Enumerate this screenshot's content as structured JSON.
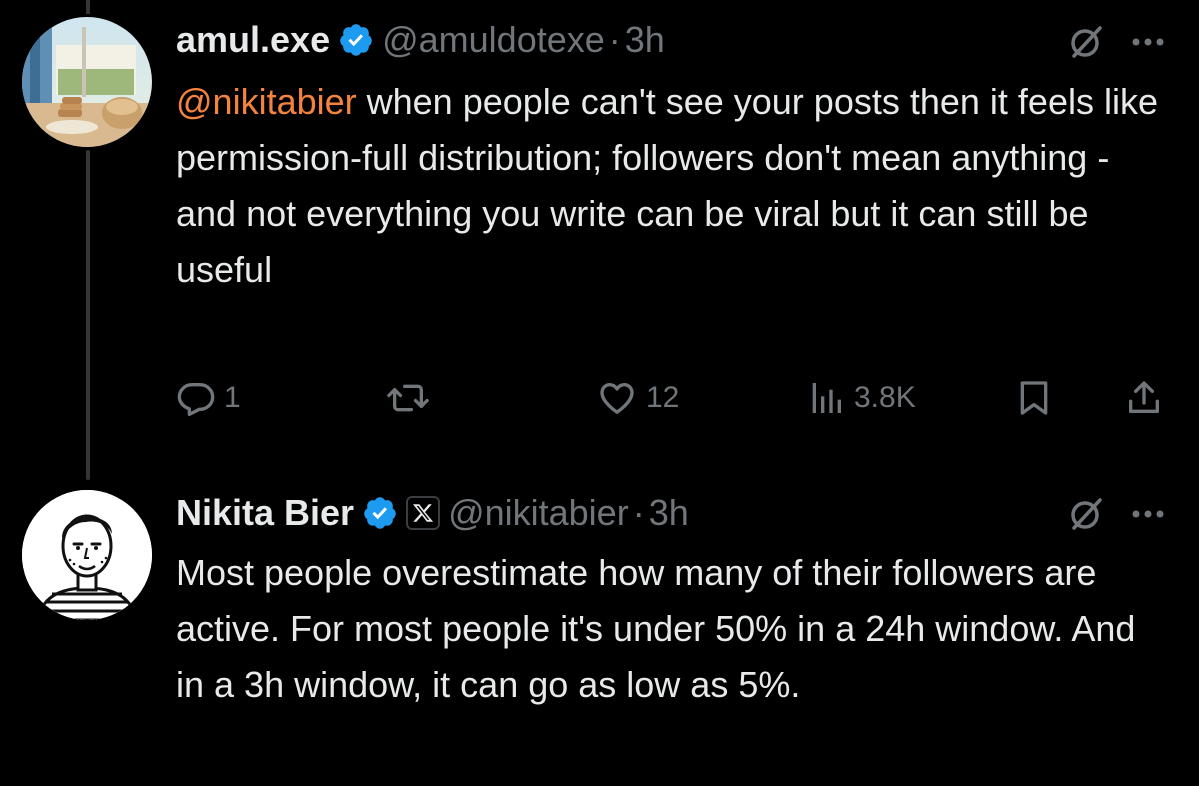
{
  "tweets": [
    {
      "author_name": "amul.exe",
      "handle": "@amuldotexe",
      "separator": "·",
      "time": "3h",
      "mention": "@nikitabier",
      "text": " when people can't see your posts then it feels like permission-full distribution; followers don't mean anything - and not everything you write can be viral but it can still be useful",
      "actions": {
        "replies": "1",
        "reposts": "",
        "likes": "12",
        "views": "3.8K"
      }
    },
    {
      "author_name": "Nikita Bier",
      "handle": "@nikitabier",
      "separator": "·",
      "time": "3h",
      "text": "Most people overestimate how many of their followers are active. For most people it's under 50% in a 24h window. And in a 3h window, it can go as low as 5%."
    }
  ],
  "icons": {
    "verified": "verified-badge-icon",
    "affiliate": "x-logo-icon",
    "grok": "grok-icon",
    "more": "more-icon",
    "reply": "reply-icon",
    "repost": "repost-icon",
    "like": "heart-icon",
    "views": "views-icon",
    "bookmark": "bookmark-icon",
    "share": "share-icon"
  },
  "colors": {
    "background": "#000000",
    "text": "#e7e9ea",
    "secondary": "#71767b",
    "mention": "#f4833d",
    "verified": "#1d9bf0"
  }
}
